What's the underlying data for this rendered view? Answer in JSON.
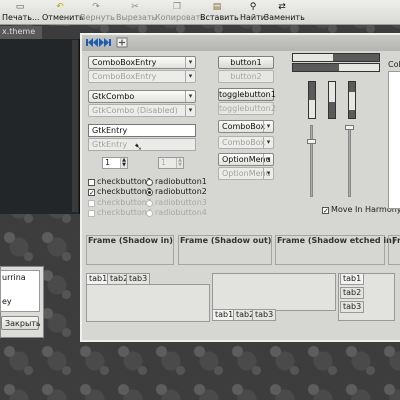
{
  "toolbar": {
    "items": [
      {
        "label": "Печать...",
        "icon": "print-icon",
        "disabled": false
      },
      {
        "label": "Отменить",
        "icon": "undo-icon",
        "disabled": false
      },
      {
        "label": "Вернуть",
        "icon": "redo-icon",
        "disabled": true
      },
      {
        "label": "Вырезать",
        "icon": "cut-icon",
        "disabled": true
      },
      {
        "label": "Копировать",
        "icon": "copy-icon",
        "disabled": true
      },
      {
        "label": "Вставить",
        "icon": "paste-icon",
        "disabled": false
      },
      {
        "label": "Найти",
        "icon": "find-icon",
        "disabled": false
      },
      {
        "label": "Заменить",
        "icon": "replace-icon",
        "disabled": false
      }
    ]
  },
  "editor": {
    "tab_name": "x.theme"
  },
  "dialog": {
    "items": [
      "urrina",
      "ey"
    ],
    "close_label": "Закрыть",
    "close_underline": "З"
  },
  "preview": {
    "combo_entry": "ComboBoxEntry",
    "combo_entry_disabled": "ComboBoxEntry",
    "gtk_combo": "GtkCombo",
    "gtk_combo_disabled": "GtkCombo (Disabled)",
    "gtk_entry": "GtkEntry",
    "gtk_entry_disabled": "GtkEntry",
    "spin1": "1",
    "spin2": "1",
    "checks": [
      {
        "label": "checkbutton1",
        "checked": false,
        "disabled": false
      },
      {
        "label": "checkbutton2",
        "checked": true,
        "disabled": false
      },
      {
        "label": "checkbutton3",
        "checked": false,
        "disabled": true
      },
      {
        "label": "checkbutton4",
        "checked": false,
        "disabled": true
      }
    ],
    "radios": [
      {
        "label": "radiobutton1",
        "selected": false,
        "disabled": false
      },
      {
        "label": "radiobutton2",
        "selected": true,
        "disabled": false
      },
      {
        "label": "radiobutton3",
        "selected": false,
        "disabled": true
      },
      {
        "label": "radiobutton4",
        "selected": false,
        "disabled": true
      }
    ],
    "button1": "button1",
    "button2": "button2",
    "togglebutton1": "togglebutton1",
    "togglebutton2": "togglebutton2",
    "combobox": "ComboBox",
    "combobox_disabled": "ComboBox",
    "optionmenu": "OptionMenu",
    "optionmenu_disabled": "OptionMenu",
    "move_in_harmony": "Move In Harmony",
    "colors_label": "Colo",
    "frames": [
      "Frame (Shadow in)",
      "Frame (Shadow out)",
      "Frame (Shadow etched in)",
      "Frame"
    ],
    "tabs_top": [
      "tab1",
      "tab2",
      "tab3"
    ],
    "tabs_bottom": [
      "tab1",
      "tab2",
      "tab3"
    ],
    "tabs_right": [
      "tab1",
      "tab2",
      "tab3"
    ]
  }
}
